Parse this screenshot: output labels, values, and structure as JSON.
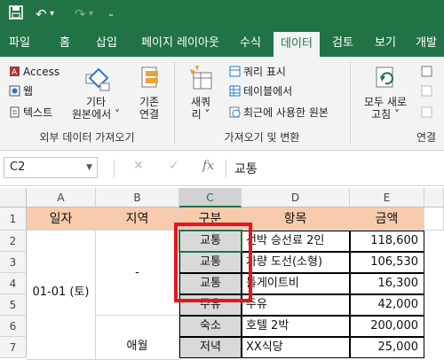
{
  "qat": {
    "save_icon": "save-icon",
    "undo_icon": "undo-icon",
    "redo_icon": "redo-icon",
    "customize_icon": "customize-qat-icon"
  },
  "tabs": [
    "파일",
    "홈",
    "삽입",
    "페이지 레이아웃",
    "수식",
    "데이터",
    "검토",
    "보기",
    "개발"
  ],
  "active_tab": "데이터",
  "ribbon": {
    "external": {
      "access": "Access",
      "web": "웹",
      "text": "텍스트",
      "other_line1": "기타",
      "other_line2": "원본에서 ˅",
      "existing_line1": "기존",
      "existing_line2": "연결",
      "label": "외부 데이터 가져오기"
    },
    "transform": {
      "new_line1": "새쿼",
      "new_line2": "리 ˅",
      "show_queries": "쿼리 표시",
      "from_table": "테이블에서",
      "recent_sources": "최근에 사용한 원본",
      "label": "가져오기 및 변환"
    },
    "connections": {
      "refresh_line1": "모두 새로",
      "refresh_line2": "고침 ˅",
      "label": "연결"
    }
  },
  "formula_bar": {
    "name_box": "C2",
    "cancel": "✕",
    "enter": "✓",
    "fx": "fx",
    "value": "교통"
  },
  "sheet": {
    "columns": [
      "A",
      "B",
      "C",
      "D",
      "E"
    ],
    "rows": [
      "1",
      "2",
      "3",
      "4",
      "5",
      "6",
      "7"
    ],
    "headers": [
      "일자",
      "지역",
      "구분",
      "항목",
      "금액"
    ],
    "date": "01-01 (토)",
    "region1": "-",
    "region2": "애월",
    "data": [
      {
        "type": "교통",
        "item": "선박 승선료 2인",
        "amount": "118,600"
      },
      {
        "type": "교통",
        "item": "차량 도선(소형)",
        "amount": "106,530"
      },
      {
        "type": "교통",
        "item": "톨게이트비",
        "amount": "16,300"
      },
      {
        "type": "주유",
        "item": "주유",
        "amount": "42,000"
      },
      {
        "type": "숙소",
        "item": "호텔 2박",
        "amount": "200,000"
      },
      {
        "type": "저녁",
        "item": "XX식당",
        "amount": "25,000"
      }
    ]
  },
  "colors": {
    "excel_green": "#217346",
    "header_fill": "#f8cbad",
    "highlight_red": "#e8141e"
  }
}
